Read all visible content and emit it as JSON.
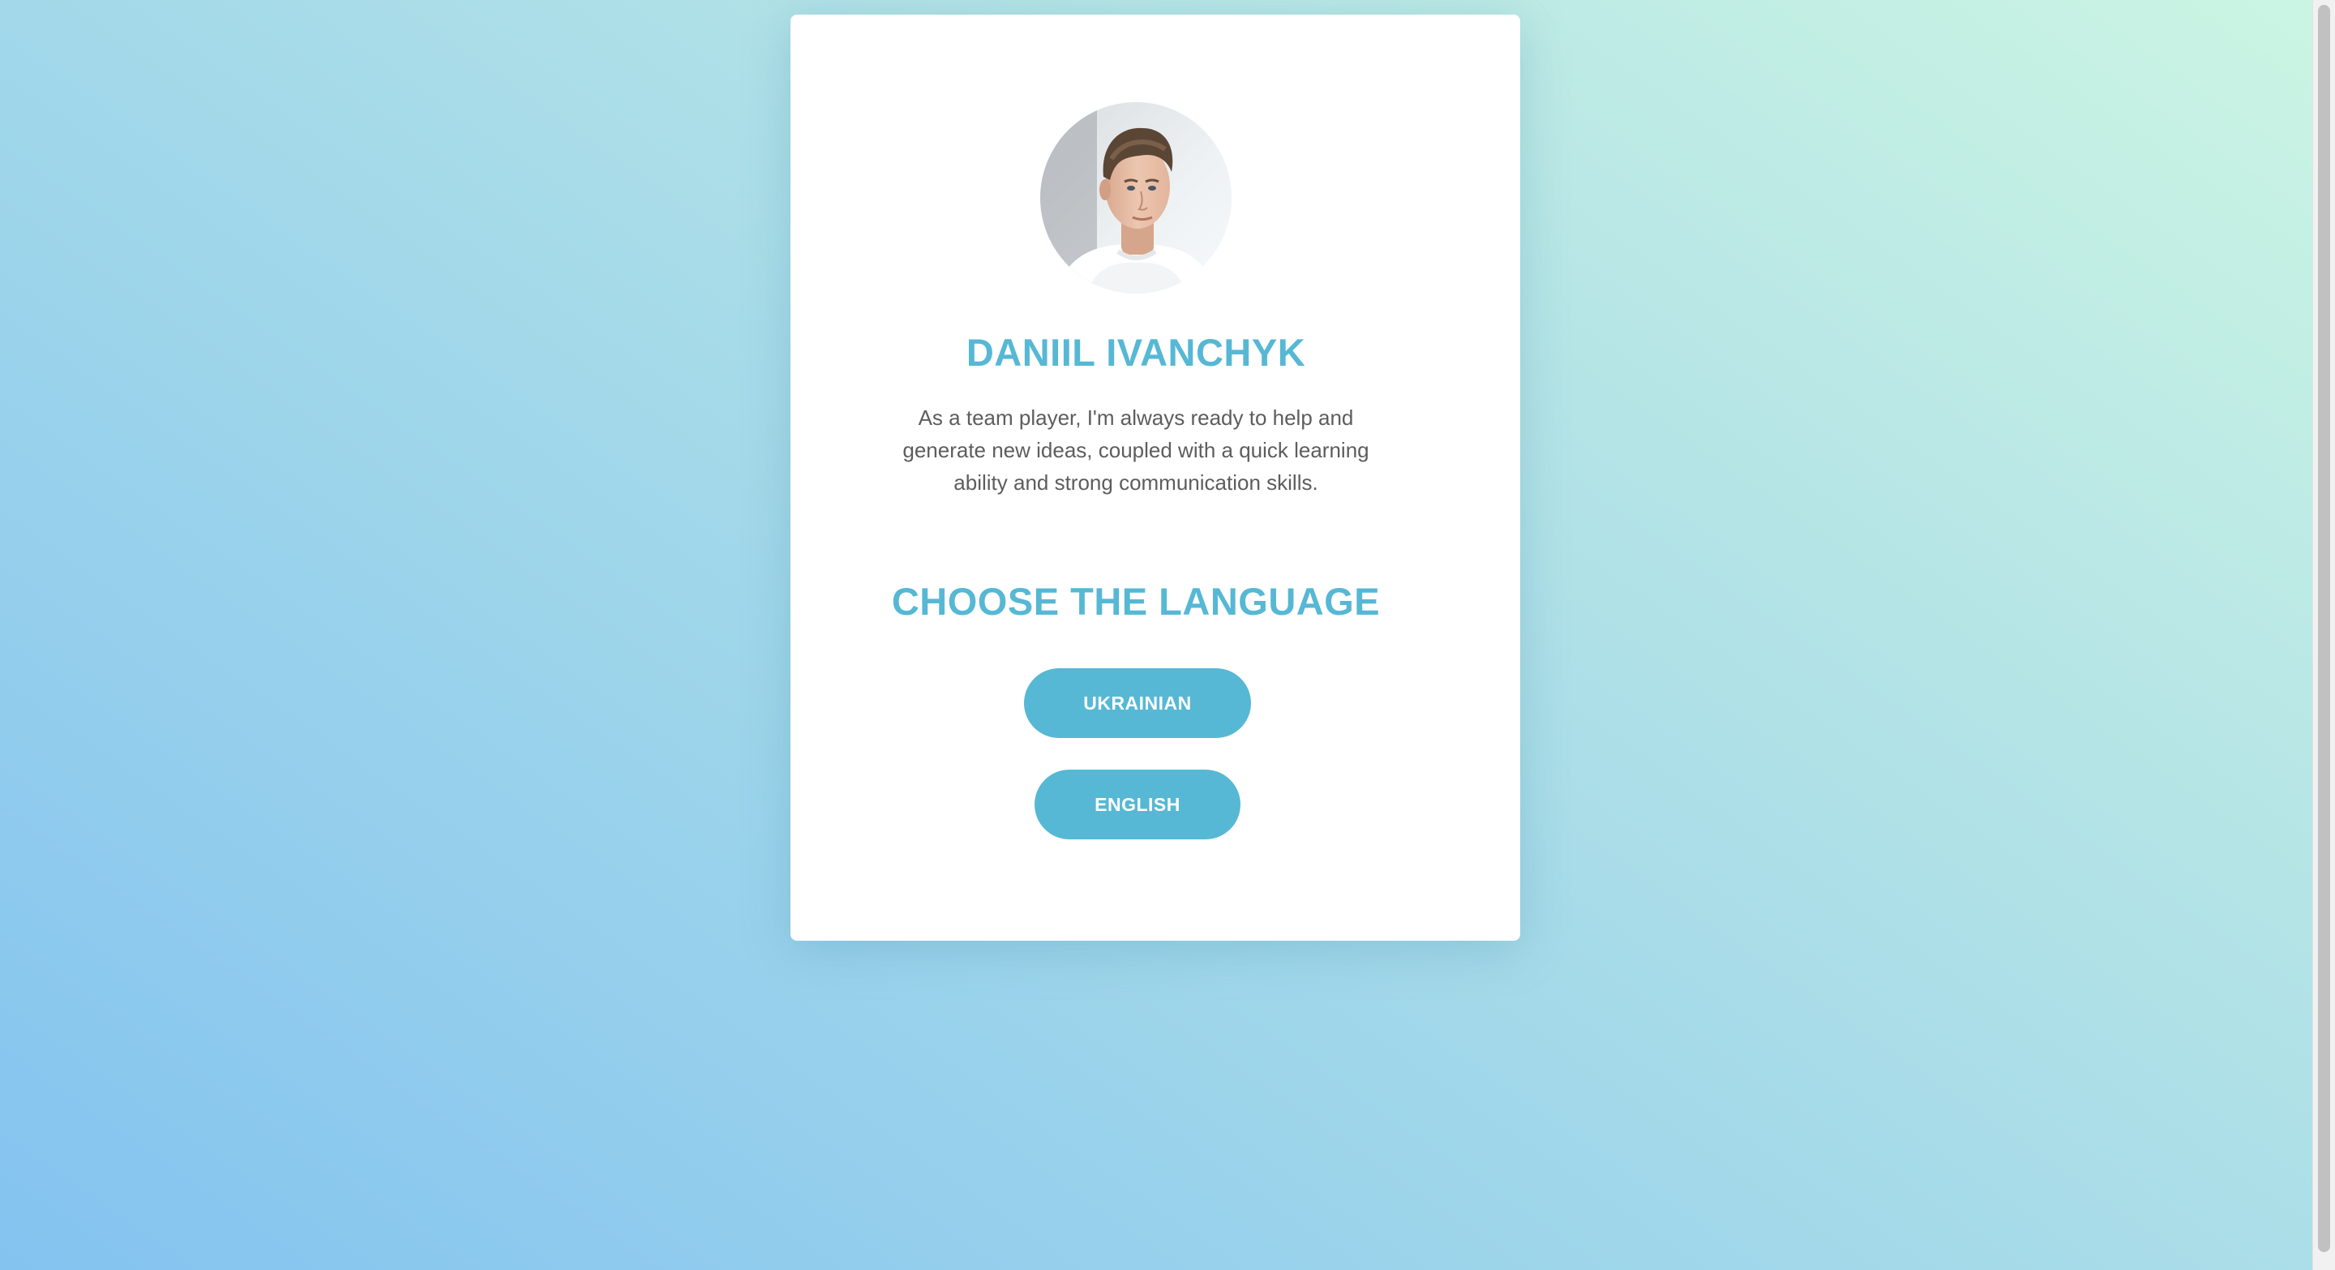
{
  "profile": {
    "name": "DANIIL IVANCHYK",
    "bio": "As a team player, I'm always ready to help and generate new ideas, coupled with a quick learning ability and strong communication skills.",
    "avatar_icon": "profile-photo"
  },
  "language": {
    "heading": "CHOOSE THE LANGUAGE",
    "options": [
      {
        "label": "UKRAINIAN"
      },
      {
        "label": "ENGLISH"
      }
    ]
  },
  "colors": {
    "accent": "#56b8d4",
    "text": "#5d5d5d",
    "card": "#ffffff",
    "background_start": "#84c3f0",
    "background_end": "#cbf5e3"
  }
}
